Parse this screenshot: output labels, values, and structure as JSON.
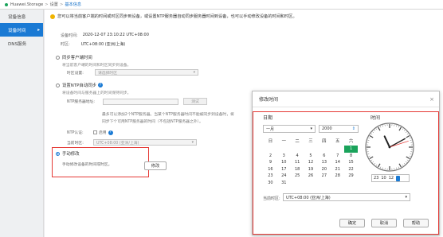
{
  "breadcrumb": {
    "app": "Huawei.Storage",
    "sep": ">",
    "level1": "设置",
    "level2": "基本信息"
  },
  "sidebar": {
    "items": [
      {
        "label": "设备信息"
      },
      {
        "label": "设备时间",
        "arrow": "▸"
      },
      {
        "label": "DNS服务"
      }
    ]
  },
  "notice": "您可以将当前客户端的时间或时区同步到设备，或设置NTP服务器自动同步服务器时间到设备，也可以手动修改设备的时间和时区。",
  "device_time": {
    "label": "设备时间:",
    "value": "2020-12-07 23:10:22 UTC+08:00"
  },
  "timezone": {
    "label": "时区:",
    "value": "UTC+08:00 (亚洲/上海)"
  },
  "sync_client": {
    "label": "同步客户端时间",
    "desc": "将当前客户端的时间和时区同步到设备。",
    "tz_label": "时区设置:",
    "tz_placeholder": "请选择时区"
  },
  "ntp": {
    "label": "设置NTP自动同步",
    "desc": "将设备时间与服务器上的时间保持同步。",
    "server_label": "NTP服务器地址:",
    "test_button": "测试",
    "note1": "最多可以添加2个NTP服务器。当某个NTP服务器时间不能被同步到设备时，将",
    "note2": "同步下个可用NTP服务器的时间（不包括NTP服务器之外）。",
    "auth_label": "NTP认证:",
    "auth_check": "启用",
    "zone_label": "当前时区:",
    "zone_value": "UTC+08:00 (亚洲/上海)"
  },
  "manual": {
    "label": "手动修改",
    "desc": "手动修改设备的时间或时区。",
    "button": "修改"
  },
  "dialog": {
    "title": "修改时间",
    "close": "×",
    "date_label": "日期",
    "time_label": "时间",
    "month": "一月",
    "year": "2000",
    "weekdays": [
      "日",
      "一",
      "二",
      "三",
      "四",
      "五",
      "六"
    ],
    "days": [
      "",
      "",
      "",
      "",
      "",
      "",
      "1",
      "2",
      "3",
      "4",
      "5",
      "6",
      "7",
      "8",
      "9",
      "10",
      "11",
      "12",
      "13",
      "14",
      "15",
      "16",
      "17",
      "18",
      "19",
      "20",
      "21",
      "22",
      "23",
      "24",
      "25",
      "26",
      "27",
      "28",
      "29",
      "30",
      "31",
      "",
      "",
      "",
      "",
      "",
      ""
    ],
    "today": "1",
    "hour": "23",
    "minute": "10",
    "second": "12",
    "current_tz_label": "当前时区:",
    "current_tz_value": "UTC+08:00 (亚洲/上海)",
    "ok": "确定",
    "cancel": "取消",
    "help": "帮助"
  },
  "colors": {
    "accent": "#1a7ad4",
    "today": "#1aa35b",
    "highlight": "#e53935"
  }
}
